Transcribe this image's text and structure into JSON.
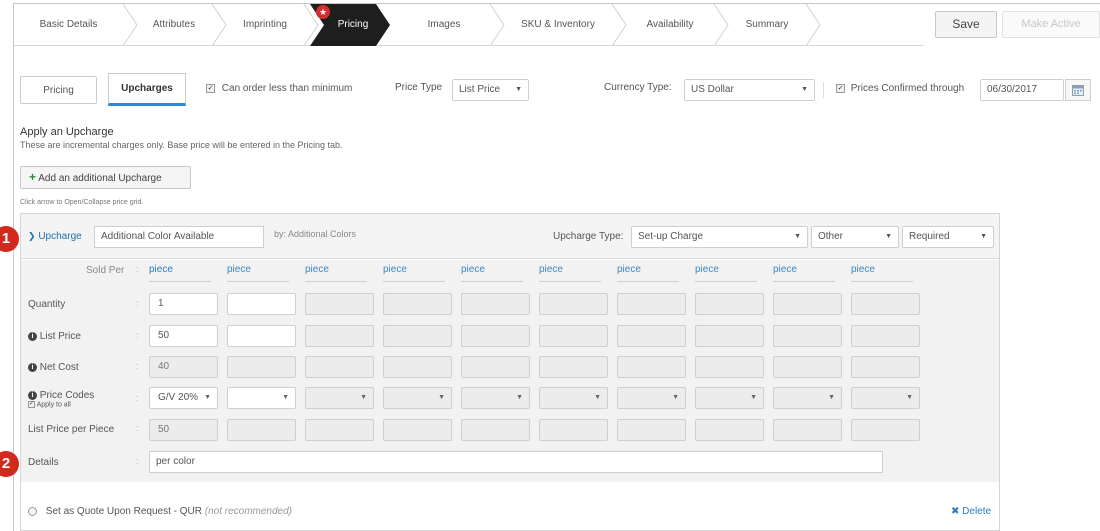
{
  "steps": [
    "Basic Details",
    "Attributes",
    "Imprinting",
    "Pricing",
    "Images",
    "SKU & Inventory",
    "Availability",
    "Summary"
  ],
  "active_step": "Pricing",
  "header": {
    "save_label": "Save",
    "make_active_label": "Make Active"
  },
  "toolbar": {
    "tab_pricing": "Pricing",
    "tab_upcharges": "Upcharges",
    "can_order_less_label": "Can order less than minimum",
    "can_order_less_checked": true,
    "price_type_label": "Price Type",
    "price_type_value": "List Price",
    "currency_type_label": "Currency Type:",
    "currency_value": "US Dollar",
    "prices_confirmed_label": "Prices Confirmed through",
    "prices_confirmed_checked": true,
    "prices_confirmed_date": "06/30/2017"
  },
  "apply": {
    "title": "Apply an Upcharge",
    "subtitle": "These are incremental charges only. Base price will be entered in the Pricing tab.",
    "add_button_label": "Add an additional Upcharge",
    "hint": "Click arrow to Open/Collapse price grid."
  },
  "upcharge": {
    "label": "Upcharge",
    "name_value": "Additional Color Available",
    "by_label": "by: Additional Colors",
    "type_label": "Upcharge Type:",
    "type_value": "Set-up Charge",
    "other_value": "Other",
    "required_value": "Required"
  },
  "grid": {
    "sold_per_label": "Sold Per",
    "sold_per": [
      "piece",
      "piece",
      "piece",
      "piece",
      "piece",
      "piece",
      "piece",
      "piece",
      "piece",
      "piece"
    ],
    "row_labels": {
      "quantity": "Quantity",
      "list_price": "List Price",
      "net_cost": "Net Cost",
      "price_codes": "Price Codes",
      "apply_to_all": "Apply to all",
      "list_price_per_piece": "List Price per Piece",
      "details": "Details"
    },
    "quantity": [
      "1",
      "",
      "",
      "",
      "",
      "",
      "",
      "",
      "",
      ""
    ],
    "list_price": [
      "50",
      "",
      "",
      "",
      "",
      "",
      "",
      "",
      "",
      ""
    ],
    "net_cost": [
      "40",
      "",
      "",
      "",
      "",
      "",
      "",
      "",
      "",
      ""
    ],
    "price_codes": [
      "G/V 20%",
      "",
      "",
      "",
      "",
      "",
      "",
      "",
      "",
      ""
    ],
    "list_price_per_piece": [
      "50",
      "",
      "",
      "",
      "",
      "",
      "",
      "",
      "",
      ""
    ],
    "details_value": "per color"
  },
  "footer": {
    "qur_label": "Set as Quote Upon Request - QUR",
    "qur_note": "(not recommended)",
    "delete_label": "Delete"
  },
  "badges": [
    "1",
    "2"
  ],
  "colors": {
    "active_step": "#1e1e1e",
    "badge": "#d1291d",
    "link": "#2a7dc2"
  }
}
